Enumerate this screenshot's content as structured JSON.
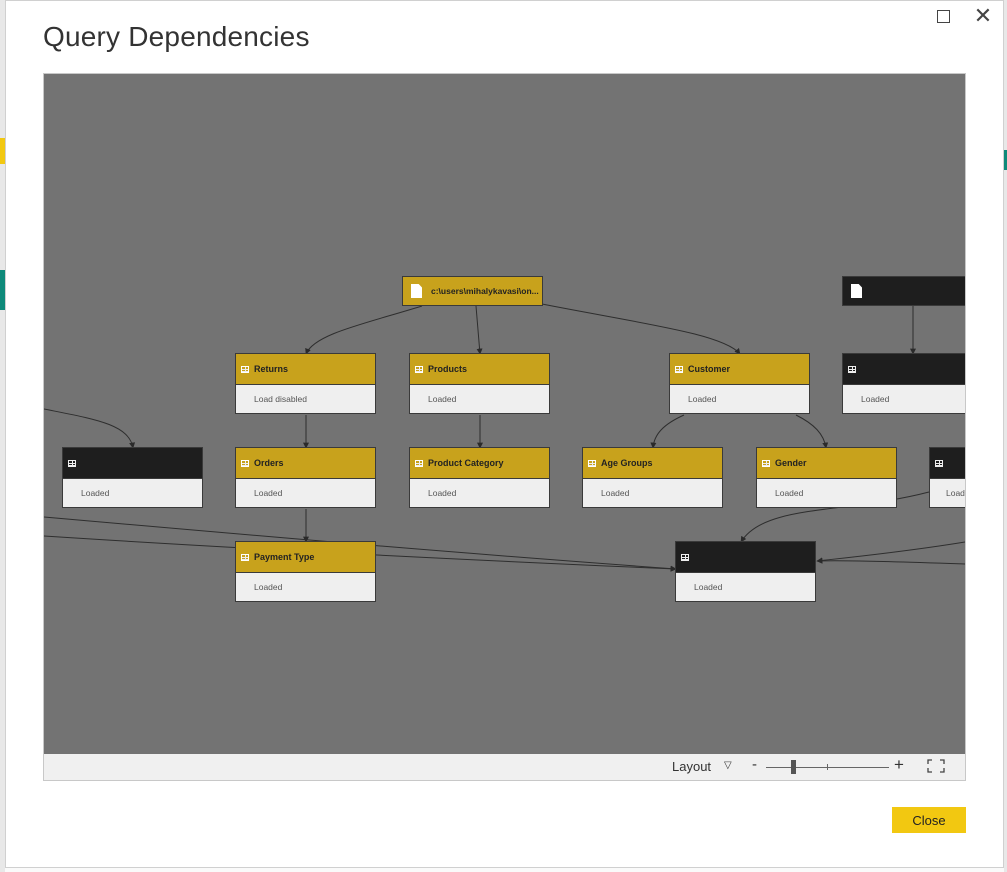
{
  "dialog": {
    "title": "Query Dependencies",
    "close_label": "Close"
  },
  "source_nodes": {
    "file_path": "c:\\users\\mihalykavasi\\on...",
    "dark_file": ""
  },
  "nodes": {
    "returns": {
      "name": "Returns",
      "status": "Load disabled"
    },
    "products": {
      "name": "Products",
      "status": "Loaded"
    },
    "customer": {
      "name": "Customer",
      "status": "Loaded"
    },
    "dark_right": {
      "name": "",
      "status": "Loaded"
    },
    "dark_left": {
      "name": "",
      "status": "Loaded"
    },
    "orders": {
      "name": "Orders",
      "status": "Loaded"
    },
    "product_category": {
      "name": "Product Category",
      "status": "Loaded"
    },
    "age_groups": {
      "name": "Age Groups",
      "status": "Loaded"
    },
    "gender": {
      "name": "Gender",
      "status": "Loaded"
    },
    "dark_edge": {
      "name": "",
      "status": "Load"
    },
    "payment_type": {
      "name": "Payment Type",
      "status": "Loaded"
    },
    "dark_center": {
      "name": "",
      "status": "Loaded"
    }
  },
  "toolbar": {
    "layout_label": "Layout",
    "zoom_minus": "-",
    "zoom_plus": "+"
  },
  "colors": {
    "canvas": "#737373",
    "loaded_header": "#c8a21c",
    "hidden_header": "#1e1e1e",
    "close_button": "#f2c811"
  },
  "icons": [
    "maximize-icon",
    "close-icon",
    "file-icon",
    "table-icon",
    "chevron-down-icon",
    "fit-to-screen-icon"
  ]
}
